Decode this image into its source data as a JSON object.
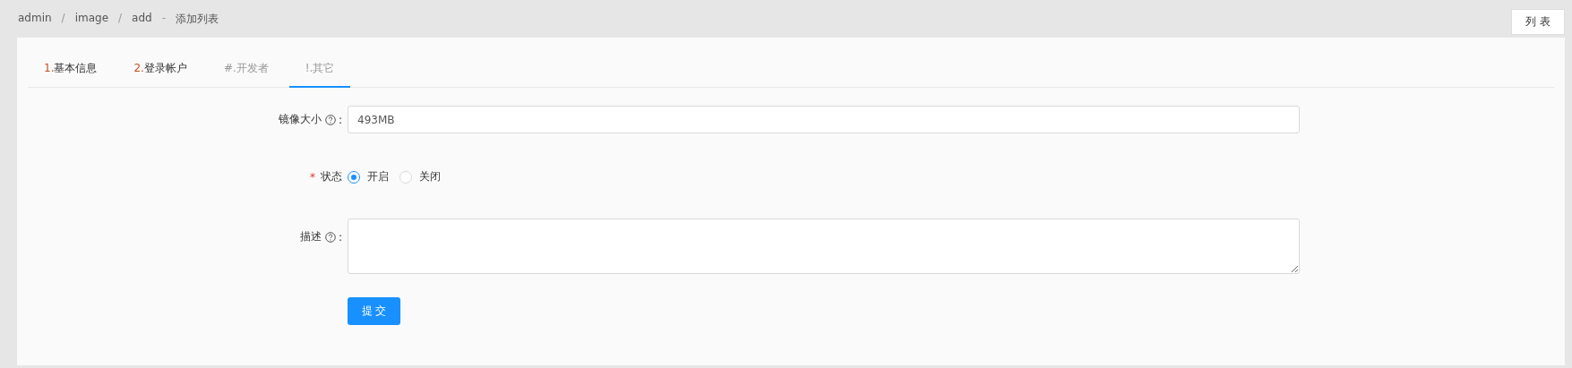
{
  "breadcrumb": [
    {
      "kind": "link",
      "text": "admin"
    },
    {
      "kind": "sep",
      "text": "/"
    },
    {
      "kind": "link",
      "text": "image"
    },
    {
      "kind": "sep",
      "text": "/"
    },
    {
      "kind": "link",
      "text": "add"
    },
    {
      "kind": "sep",
      "text": "-"
    },
    {
      "kind": "title",
      "text": "添加列表"
    }
  ],
  "list_button": "列 表",
  "tabs": [
    {
      "prefix": "1.",
      "label": "基本信息",
      "kind": "done",
      "selected": false
    },
    {
      "prefix": "2.",
      "label": "登录帐户",
      "kind": "done",
      "selected": false
    },
    {
      "prefix": "#.",
      "label": "开发者",
      "kind": "pending",
      "selected": false
    },
    {
      "prefix": "!.",
      "label": "其它",
      "kind": "pending",
      "selected": true
    }
  ],
  "form": {
    "image_size": {
      "label": "镜像大小",
      "help": true,
      "colon": ":",
      "value": "493MB"
    },
    "status": {
      "label": "状态",
      "required_mark": "*",
      "options": [
        {
          "label": "开启",
          "selected": true
        },
        {
          "label": "关闭",
          "selected": false
        }
      ]
    },
    "description": {
      "label": "描述",
      "help": true,
      "colon": ":"
    },
    "submit": "提 交"
  }
}
